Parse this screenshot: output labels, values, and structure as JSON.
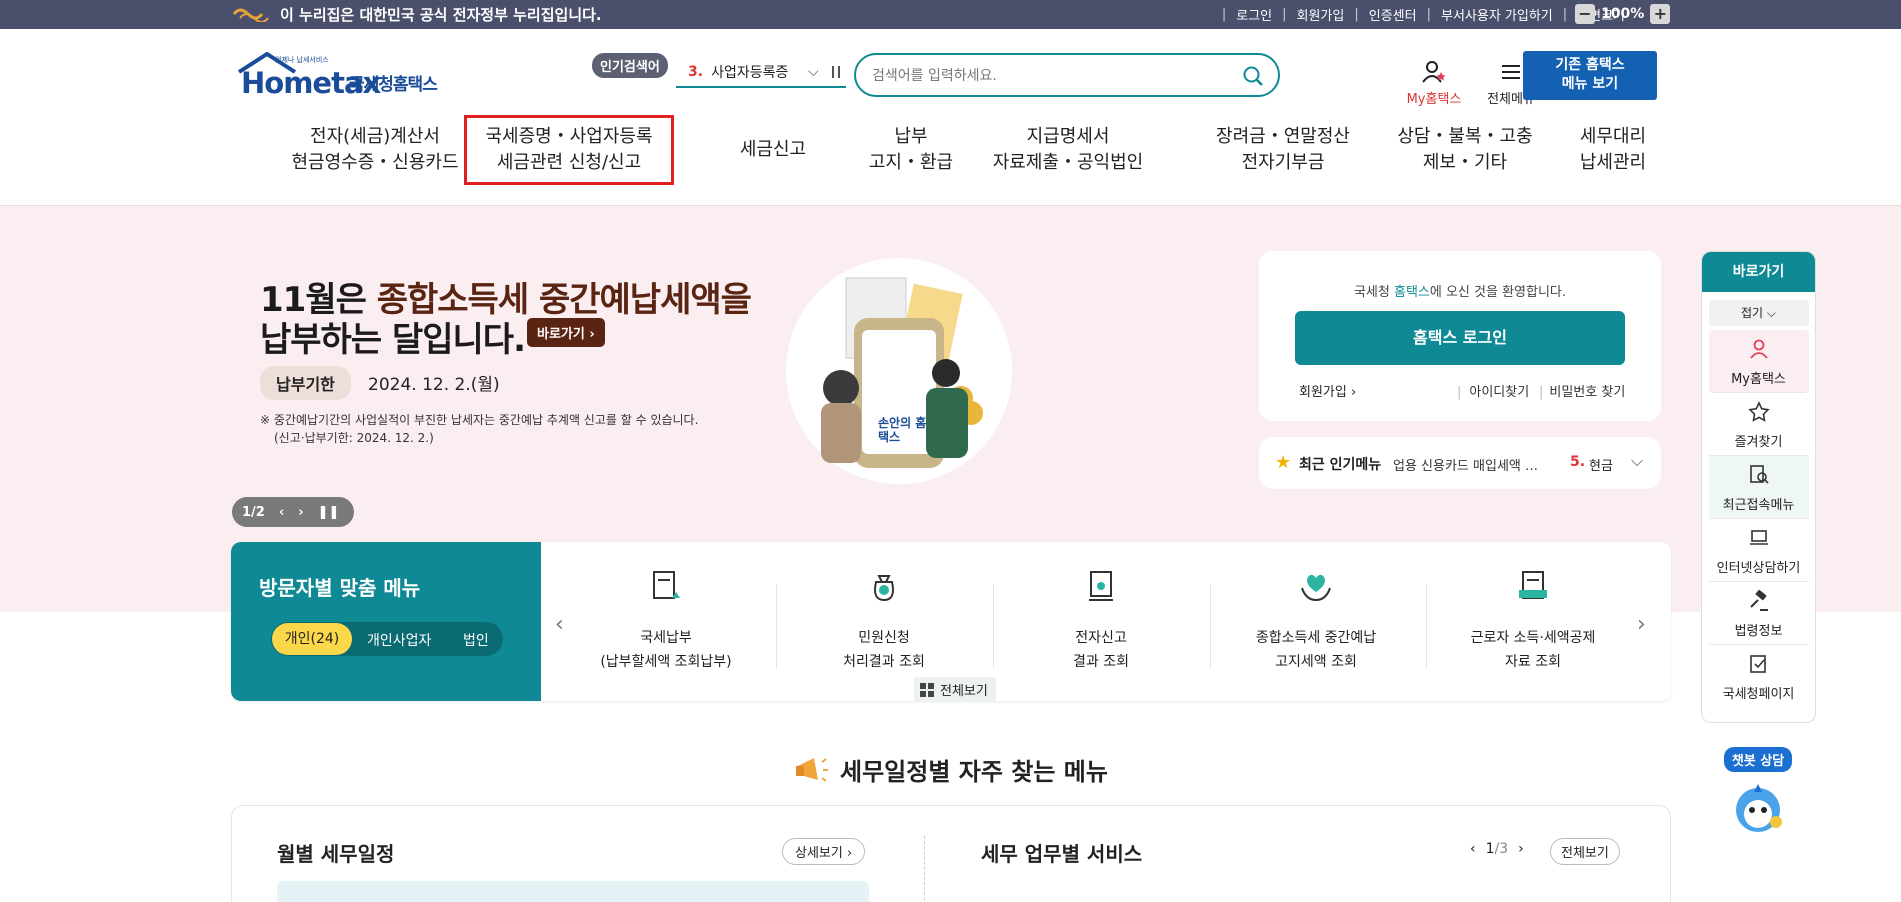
{
  "topbar": {
    "gov_text": "이 누리집은 대한민국 공식 전자정부 누리집입니다.",
    "links": [
      "로그인",
      "회원가입",
      "인증센터",
      "부서사용자 가입하기",
      "화면크기"
    ],
    "zoom_minus": "−",
    "zoom_value": "100%",
    "zoom_plus": "+"
  },
  "logo": {
    "brand": "Hometax",
    "korean": "국세청홈택스",
    "sub": "언제나 납세서비스"
  },
  "popular": {
    "badge": "인기검색어",
    "rank": "3.",
    "keyword": "사업자등록증",
    "chevron": "⌵"
  },
  "search": {
    "placeholder": "검색어를 입력하세요."
  },
  "header": {
    "my_hometax": "My홈택스",
    "all_menu": "전체메뉴",
    "old_menu_line1": "기존 홈택스",
    "old_menu_line2": "메뉴 보기"
  },
  "gnb": [
    {
      "l1": "전자(세금)계산서",
      "l2": "현금영수증・신용카드"
    },
    {
      "l1": "국세증명・사업자등록",
      "l2": "세금관련 신청/신고"
    },
    {
      "l1": "세금신고",
      "l2": ""
    },
    {
      "l1": "납부",
      "l2": "고지・환급"
    },
    {
      "l1": "지급명세서",
      "l2": "자료제출・공익법인"
    },
    {
      "l1": "장려금・연말정산",
      "l2": "전자기부금"
    },
    {
      "l1": "상담・불복・고충",
      "l2": "제보・기타"
    },
    {
      "l1": "세무대리",
      "l2": "납세관리"
    }
  ],
  "hero": {
    "t1_a": "11월은 ",
    "t1_em": "종합소득세 중간예납세액을",
    "t2": "납부하는 달입니다.",
    "go": "바로가기",
    "due_label": "납부기한",
    "due_date": "2024. 12. 2.(월)",
    "note1": "※ 중간예납기간의 사업실적이 부진한 납세자는 중간예납 추계액 신고를 할 수 있습니다.",
    "note2": "(신고·납부기한: 2024. 12. 2.)",
    "illustration_text": "손안의 홈택스",
    "pager": "1/2"
  },
  "login": {
    "welcome_a": "국세청 ",
    "welcome_b": "홈택스",
    "welcome_c": "에 오신 것을 환영합니다.",
    "button": "홈택스 로그인",
    "join": "회원가입",
    "find_id": "아이디찾기",
    "find_pw": "비밀번호 찾기"
  },
  "recent_popular": {
    "label": "최근 인기메뉴",
    "value": "업용 신용카드 매입세액 …",
    "rank": "5.",
    "item": "현금"
  },
  "visitor": {
    "title": "방문자별 맞춤 메뉴",
    "tabs": [
      "개인(24)",
      "개인사업자",
      "법인"
    ],
    "items": [
      {
        "l1": "국세납부",
        "l2": "(납부할세액 조회납부)"
      },
      {
        "l1": "민원신청",
        "l2": "처리결과 조회"
      },
      {
        "l1": "전자신고",
        "l2": "결과 조회"
      },
      {
        "l1": "종합소득세 중간예납",
        "l2": "고지세액 조회"
      },
      {
        "l1": "근로자 소득·세액공제",
        "l2": "자료 조회"
      }
    ],
    "view_all": "전체보기"
  },
  "schedule": {
    "section_title": "세무일정별 자주 찾는 메뉴",
    "monthly": "월별 세무일정",
    "detail": "상세보기",
    "services": "세무 업무별 서비스",
    "page": "1",
    "total": "/3",
    "view_all": "전체보기"
  },
  "quick": {
    "title": "바로가기",
    "fold": "접기",
    "items": [
      "My홈택스",
      "즐겨찾기",
      "최근접속메뉴",
      "인터넷상담하기",
      "법령정보",
      "국세청페이지"
    ]
  },
  "chatbot": {
    "label": "챗봇 상담"
  },
  "colors": {
    "teal": "#0f8a94",
    "topbar": "#4a4f6c",
    "hero_bg": "#fbeef0",
    "highlight": "#e02020",
    "blue": "#1461b3"
  }
}
